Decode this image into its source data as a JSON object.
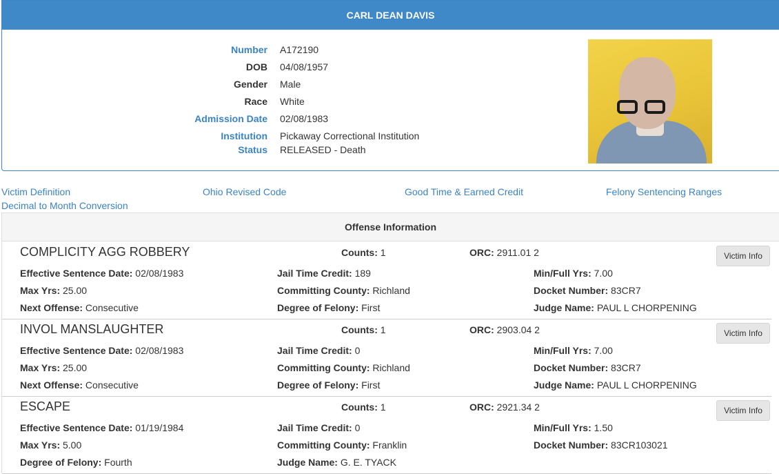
{
  "inmate": {
    "name": "CARL DEAN DAVIS",
    "fields": [
      {
        "label": "Number",
        "value": "A172190",
        "link": true
      },
      {
        "label": "DOB",
        "value": "04/08/1957",
        "link": false
      },
      {
        "label": "Gender",
        "value": "Male",
        "link": false
      },
      {
        "label": "Race",
        "value": "White",
        "link": false
      },
      {
        "label": "Admission Date",
        "value": "02/08/1983",
        "link": true
      },
      {
        "label": "Institution",
        "value": "Pickaway Correctional Institution",
        "link": true
      },
      {
        "label": "Status",
        "value": "RELEASED - Death",
        "link": true
      }
    ]
  },
  "links": [
    "Victim Definition",
    "Ohio Revised Code",
    "Good Time & Earned Credit",
    "Felony Sentencing Ranges",
    "Decimal to Month Conversion"
  ],
  "offense_panel_title": "Offense Information",
  "victim_button_label": "Victim Info",
  "labels": {
    "counts": "Counts:",
    "orc": "ORC:",
    "eff_date": "Effective Sentence Date:",
    "jail_credit": "Jail Time Credit:",
    "min_full": "Min/Full Yrs:",
    "max_yrs": "Max Yrs:",
    "county": "Committing County:",
    "docket": "Docket Number:",
    "next_offense": "Next Offense:",
    "degree": "Degree of Felony:",
    "judge": "Judge Name:"
  },
  "offenses": [
    {
      "title": "COMPLICITY AGG ROBBERY",
      "counts": "1",
      "orc": "2911.01 2",
      "eff_date": "02/08/1983",
      "jail_credit": "189",
      "min_full": "7.00",
      "max_yrs": "25.00",
      "county": "Richland",
      "docket": "83CR7",
      "next_offense": "Consecutive",
      "degree": "First",
      "judge": "PAUL L CHORPENING"
    },
    {
      "title": "INVOL MANSLAUGHTER",
      "counts": "1",
      "orc": "2903.04 2",
      "eff_date": "02/08/1983",
      "jail_credit": "0",
      "min_full": "7.00",
      "max_yrs": "25.00",
      "county": "Richland",
      "docket": "83CR7",
      "next_offense": "Consecutive",
      "degree": "First",
      "judge": "PAUL L CHORPENING"
    },
    {
      "title": "ESCAPE",
      "counts": "1",
      "orc": "2921.34 2",
      "eff_date": "01/19/1984",
      "jail_credit": "0",
      "min_full": "1.50",
      "max_yrs": "5.00",
      "county": "Franklin",
      "docket": "83CR103021",
      "degree": "Fourth",
      "judge": "G. E. TYACK"
    }
  ],
  "colors": {
    "header_bg": "#3f89c9",
    "link": "#3a84c3"
  }
}
